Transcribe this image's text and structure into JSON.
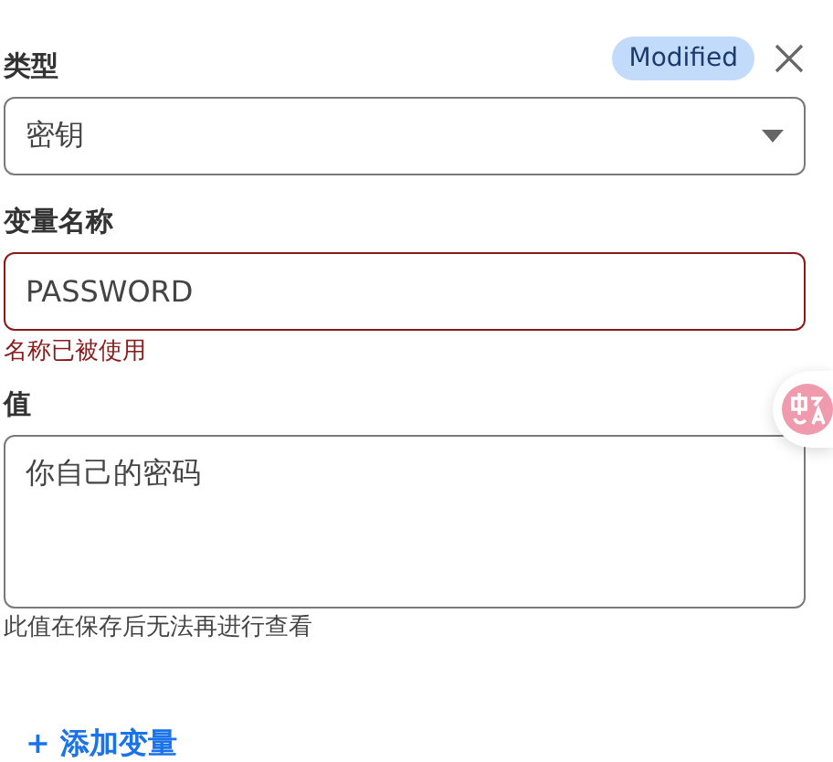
{
  "badge": "Modified",
  "fields": [
    {
      "kind": "select",
      "label": "类型",
      "value": "密钥"
    },
    {
      "kind": "input",
      "label": "变量名称",
      "value": "PASSWORD",
      "invalid": true,
      "error": "名称已被使用"
    },
    {
      "kind": "textarea",
      "label": "值",
      "value": "你自己的密码",
      "invalid": false,
      "hint": "此值在保存后无法再进行查看"
    }
  ],
  "add_button": "+ 添加变量"
}
